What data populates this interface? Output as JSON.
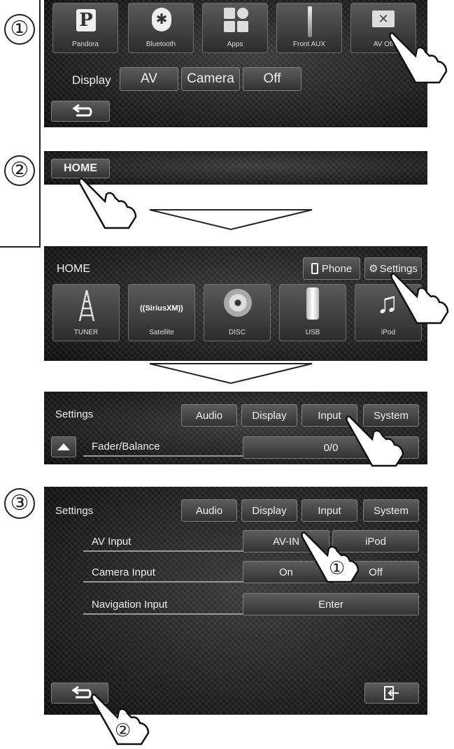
{
  "steps": {
    "s1": "①",
    "s2": "②",
    "s3": "③"
  },
  "screen1": {
    "tiles": [
      {
        "label": "Pandora",
        "glyph": "P"
      },
      {
        "label": "Bluetooth",
        "glyph": "✱"
      },
      {
        "label": "Apps",
        "glyph": ""
      },
      {
        "label": "Front AUX",
        "glyph": ""
      },
      {
        "label": "AV Off",
        "glyph": "✕"
      }
    ],
    "display_label": "Display",
    "display_options": [
      "AV",
      "Camera",
      "Off"
    ],
    "back_icon": "back-arrow-icon"
  },
  "screen2": {
    "home_button": "HOME"
  },
  "screen3": {
    "title": "HOME",
    "phone_label": "Phone",
    "settings_label": "Settings",
    "tiles": [
      {
        "label": "TUNER"
      },
      {
        "label": "Satellite",
        "logo": "((SiriusXM))"
      },
      {
        "label": "DISC"
      },
      {
        "label": "USB"
      },
      {
        "label": "iPod"
      }
    ]
  },
  "screen4": {
    "title": "Settings",
    "tabs": [
      "Audio",
      "Display",
      "Input",
      "System"
    ],
    "row_label": "Fader/Balance",
    "row_value": "0/0"
  },
  "screen5": {
    "title": "Settings",
    "tabs": [
      "Audio",
      "Display",
      "Input",
      "System"
    ],
    "rows": {
      "av_input": {
        "label": "AV Input",
        "options": [
          "AV-IN",
          "iPod"
        ]
      },
      "camera_input": {
        "label": "Camera Input",
        "options": [
          "On",
          "Off"
        ]
      },
      "navigation_input": {
        "label": "Navigation Input",
        "button": "Enter"
      }
    },
    "callout_1": "①",
    "callout_2": "②"
  },
  "colors": {
    "screen": "#2a2a2a",
    "button": "#4a4a4a",
    "text": "#f0f0f0"
  }
}
